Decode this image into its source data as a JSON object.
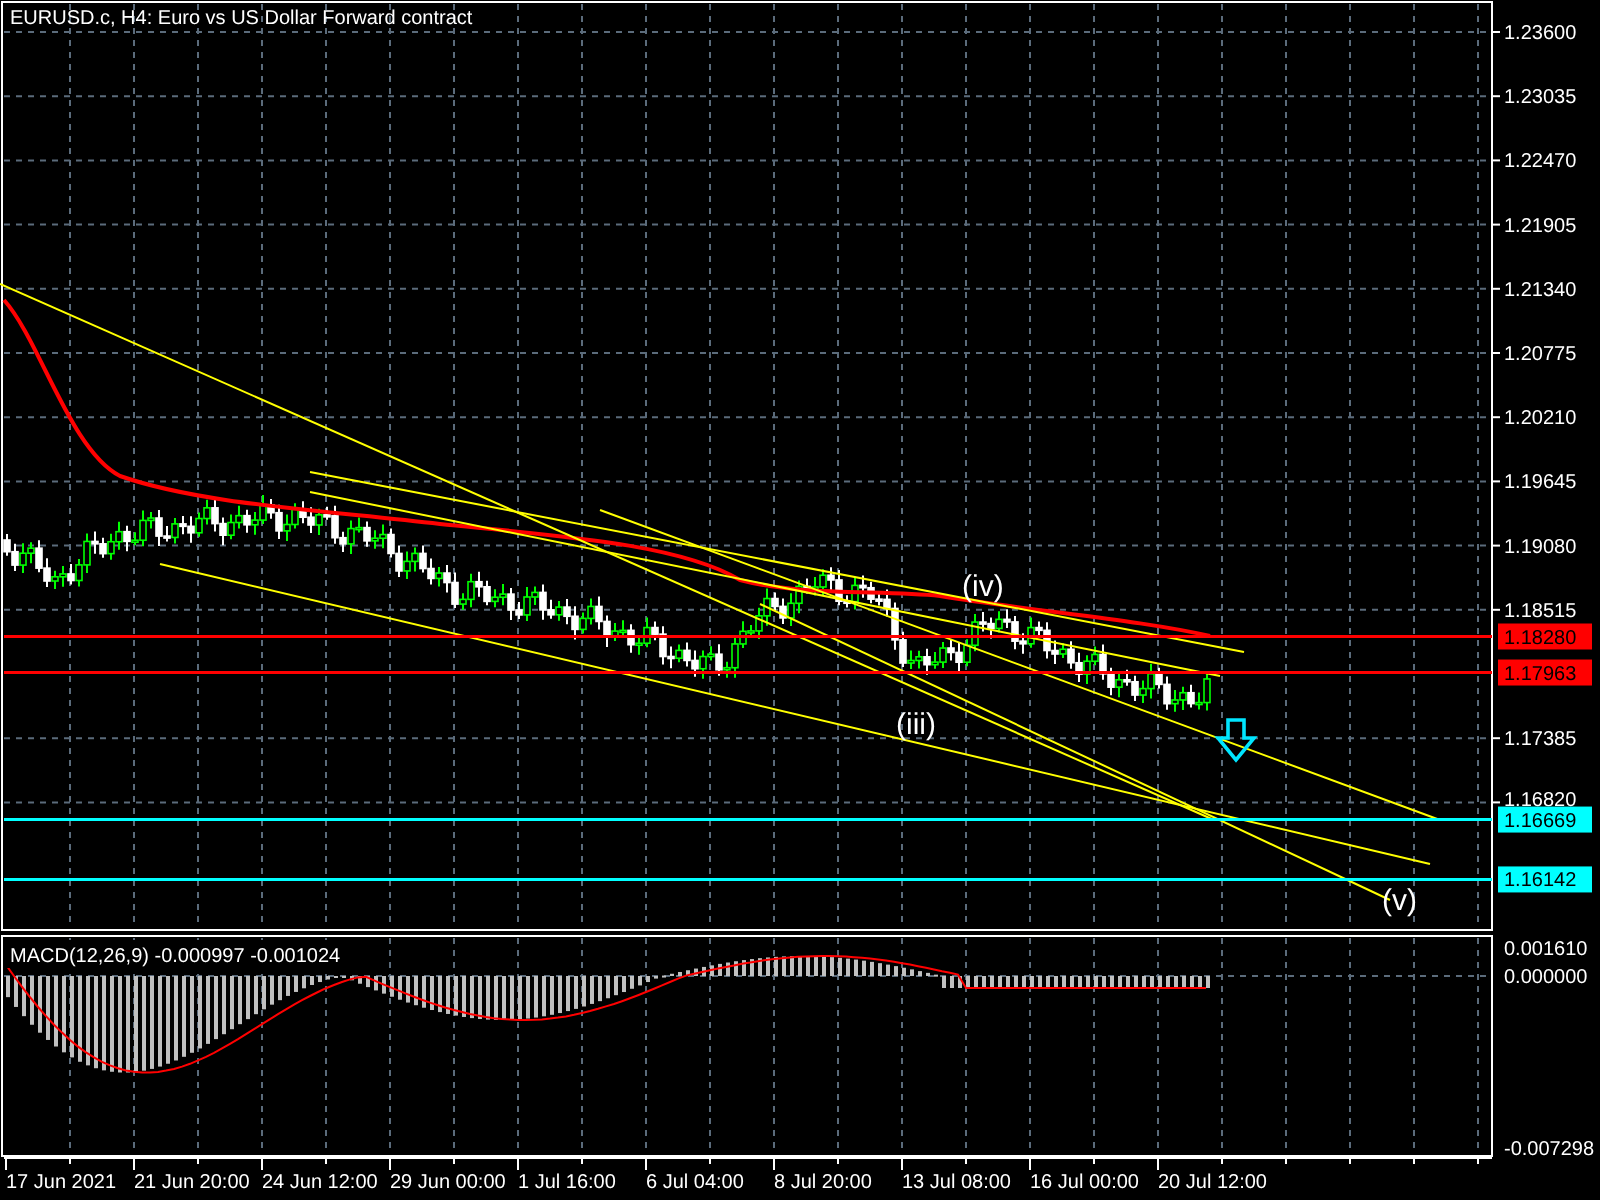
{
  "chart_title": "EURUSD.c, H4:  Euro vs US Dollar Forward contract",
  "price_axis": [
    "1.23600",
    "1.23035",
    "1.22470",
    "1.21905",
    "1.21340",
    "1.20775",
    "1.20210",
    "1.19645",
    "1.19080",
    "1.18515",
    "1.17385",
    "1.16820"
  ],
  "price_levels": [
    {
      "label": "1.18280",
      "color": "#ff0000"
    },
    {
      "label": "1.17963",
      "color": "#ff0000"
    },
    {
      "label": "1.16669",
      "color": "#00ffff"
    },
    {
      "label": "1.16142",
      "color": "#00ffff"
    }
  ],
  "wave_labels": [
    "(iii)",
    "(iv)",
    "(v)"
  ],
  "macd": {
    "label": "MACD(12,26,9) -0.000997 -0.001024",
    "axis": [
      "0.001610",
      "0.000000",
      "-0.007298"
    ]
  },
  "time_axis": [
    "17 Jun 2021",
    "21 Jun 20:00",
    "24 Jun 12:00",
    "29 Jun 00:00",
    "1 Jul 16:00",
    "6 Jul 04:00",
    "8 Jul 20:00",
    "13 Jul 08:00",
    "16 Jul 00:00",
    "20 Jul 12:00"
  ]
}
